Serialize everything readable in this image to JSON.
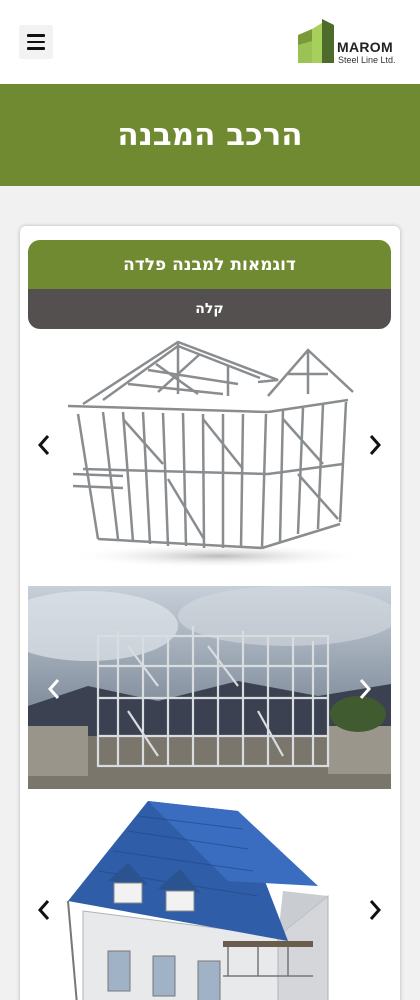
{
  "header": {
    "menu_icon": "hamburger-menu-icon",
    "logo": {
      "name": "MAROM",
      "subtitle": "Steel Line Ltd."
    }
  },
  "hero": {
    "title": "הרכב המבנה"
  },
  "gallery": {
    "tab_title": "דוגמאות למבנה פלדה",
    "tab_subtitle": "קלה",
    "prev_icon": "chevron-left-icon",
    "next_icon": "chevron-right-icon",
    "slides": [
      "steel-frame-house-render",
      "steel-frame-construction-site-photo",
      "blue-roof-house-render"
    ]
  },
  "colors": {
    "brand_green": "#6f8a30",
    "tab_dark": "#545050",
    "logo_green_light": "#8dc63f",
    "logo_green_dark": "#4d6b2a"
  }
}
